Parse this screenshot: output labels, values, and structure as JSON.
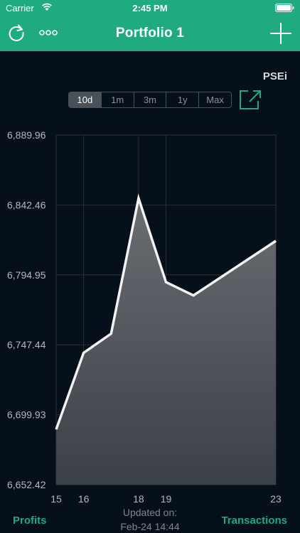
{
  "status_bar": {
    "carrier": "Carrier",
    "time": "2:45 PM"
  },
  "navbar": {
    "title": "Portfolio 1"
  },
  "index_label": "PSEi",
  "ranges": [
    {
      "label": "10d",
      "active": true
    },
    {
      "label": "1m",
      "active": false
    },
    {
      "label": "3m",
      "active": false
    },
    {
      "label": "1y",
      "active": false
    },
    {
      "label": "Max",
      "active": false
    }
  ],
  "chart_data": {
    "type": "area",
    "y_ticks": [
      "6,889.96",
      "6,842.46",
      "6,794.95",
      "6,747.44",
      "6,699.93",
      "6,652.42"
    ],
    "ylim": [
      6652.42,
      6889.96
    ],
    "x_ticks": [
      {
        "label": "15",
        "x": 15
      },
      {
        "label": "16",
        "x": 16
      },
      {
        "label": "18",
        "x": 18
      },
      {
        "label": "19",
        "x": 19
      },
      {
        "label": "23",
        "x": 23
      }
    ],
    "xlim": [
      15,
      23
    ],
    "series": [
      {
        "points": [
          {
            "x": 15,
            "y": 6690
          },
          {
            "x": 16,
            "y": 6742
          },
          {
            "x": 17,
            "y": 6755
          },
          {
            "x": 18,
            "y": 6847
          },
          {
            "x": 19,
            "y": 6790
          },
          {
            "x": 20,
            "y": 6781
          },
          {
            "x": 23,
            "y": 6818
          }
        ]
      }
    ],
    "grid": true,
    "colors": {
      "line": "#f2f2f2",
      "fill_top": "#6a6d72",
      "fill_bottom": "#3c4047",
      "grid": "#2a3038"
    }
  },
  "footer": {
    "profits": "Profits",
    "transactions": "Transactions",
    "updated_line1": "Updated on:",
    "updated_line2": "Feb-24 14:44"
  },
  "icons": [
    "wifi-icon",
    "battery-icon",
    "refresh-icon",
    "more-icon",
    "add-icon",
    "expand-icon"
  ],
  "accent_color": "#1faa80"
}
